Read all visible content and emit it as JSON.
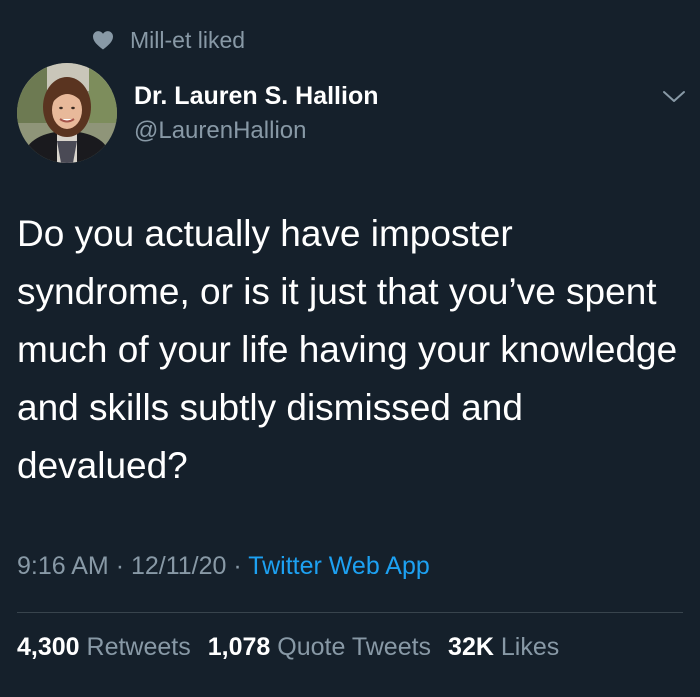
{
  "social_context": {
    "text": "Mill-et liked",
    "icon": "heart-icon"
  },
  "author": {
    "display_name": "Dr. Lauren S. Hallion",
    "handle": "@LaurenHallion"
  },
  "tweet": {
    "text": "Do you actually have imposter syndrome, or is it just that you’ve spent much of your life having your knowledge and skills subtly dismissed and devalued?",
    "time": "9:16 AM",
    "date": "12/11/20",
    "separator": "·",
    "source": "Twitter Web App"
  },
  "stats": {
    "retweets_count": "4,300",
    "retweets_label": "Retweets",
    "quotes_count": "1,078",
    "quotes_label": "Quote Tweets",
    "likes_count": "32K",
    "likes_label": "Likes"
  },
  "colors": {
    "background": "#15202b",
    "secondary_text": "#8899a6",
    "accent": "#1da1f2",
    "divider": "#38444d"
  }
}
